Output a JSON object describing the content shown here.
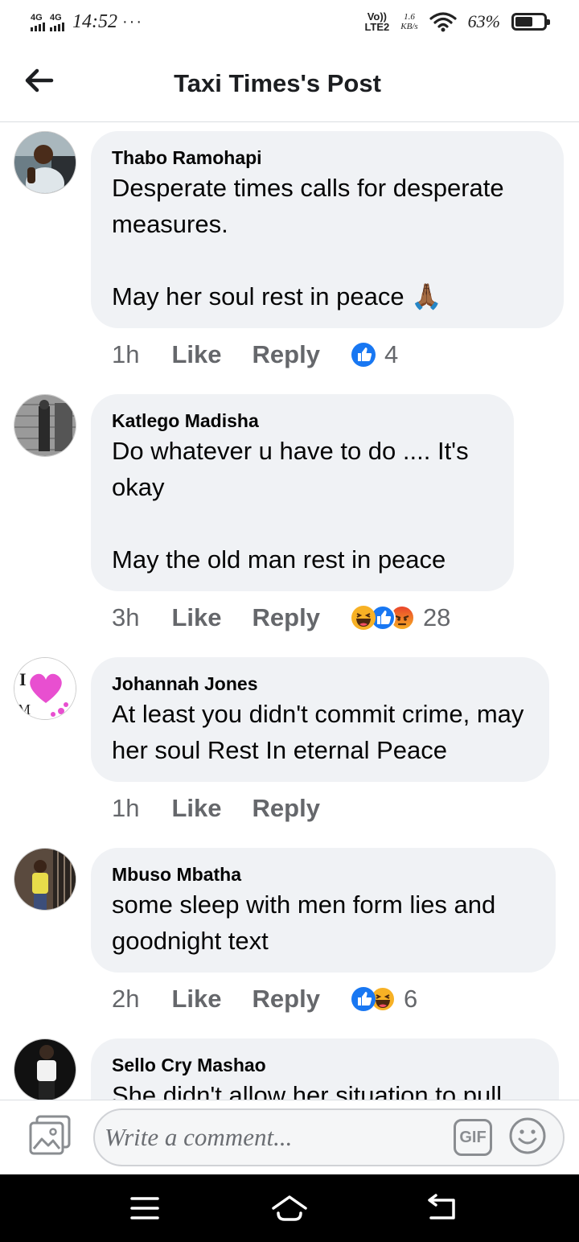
{
  "status_bar": {
    "network_1": "4G",
    "network_2": "4G",
    "time": "14:52",
    "more": "···",
    "volte": "Vo))",
    "lte": "LTE2",
    "speed_value": "1.6",
    "speed_unit": "KB/s",
    "battery_percent": "63%",
    "battery_level": 0.63
  },
  "header": {
    "title": "Taxi Times's Post"
  },
  "comments": [
    {
      "name": "Thabo Ramohapi",
      "text": "Desperate times calls for desperate measures.\n\nMay her soul rest in peace 🙏🏾",
      "time": "1h",
      "like": "Like",
      "reply": "Reply",
      "reactions": [
        "like-icon"
      ],
      "reaction_count": "4"
    },
    {
      "name": "Katlego Madisha",
      "text": "Do whatever u have to do .... It's okay\n\nMay the old man rest in peace",
      "time": "3h",
      "like": "Like",
      "reply": "Reply",
      "reactions": [
        "haha-icon",
        "like-icon",
        "angry-icon"
      ],
      "reaction_count": "28"
    },
    {
      "name": "Johannah Jones",
      "text": "At least you didn't commit crime, may her soul Rest In eternal Peace",
      "time": "1h",
      "like": "Like",
      "reply": "Reply",
      "reactions": [],
      "reaction_count": ""
    },
    {
      "name": "Mbuso Mbatha",
      "text": "some sleep with men form lies and goodnight text",
      "time": "2h",
      "like": "Like",
      "reply": "Reply",
      "reactions": [
        "like-icon",
        "haha-icon"
      ],
      "reaction_count": "6"
    },
    {
      "name": "Sello Cry Mashao",
      "text": "She didn't allow her situation to pull",
      "time": "",
      "like": "",
      "reply": "",
      "reactions": [],
      "reaction_count": ""
    }
  ],
  "composer": {
    "placeholder": "Write a comment...",
    "gif_label": "GIF"
  },
  "colors": {
    "bubble": "#f0f2f5",
    "like_blue": "#1877f2",
    "haha_yellow": "#f7b125",
    "angry_red": "#e9710f",
    "muted_text": "#65676b"
  }
}
